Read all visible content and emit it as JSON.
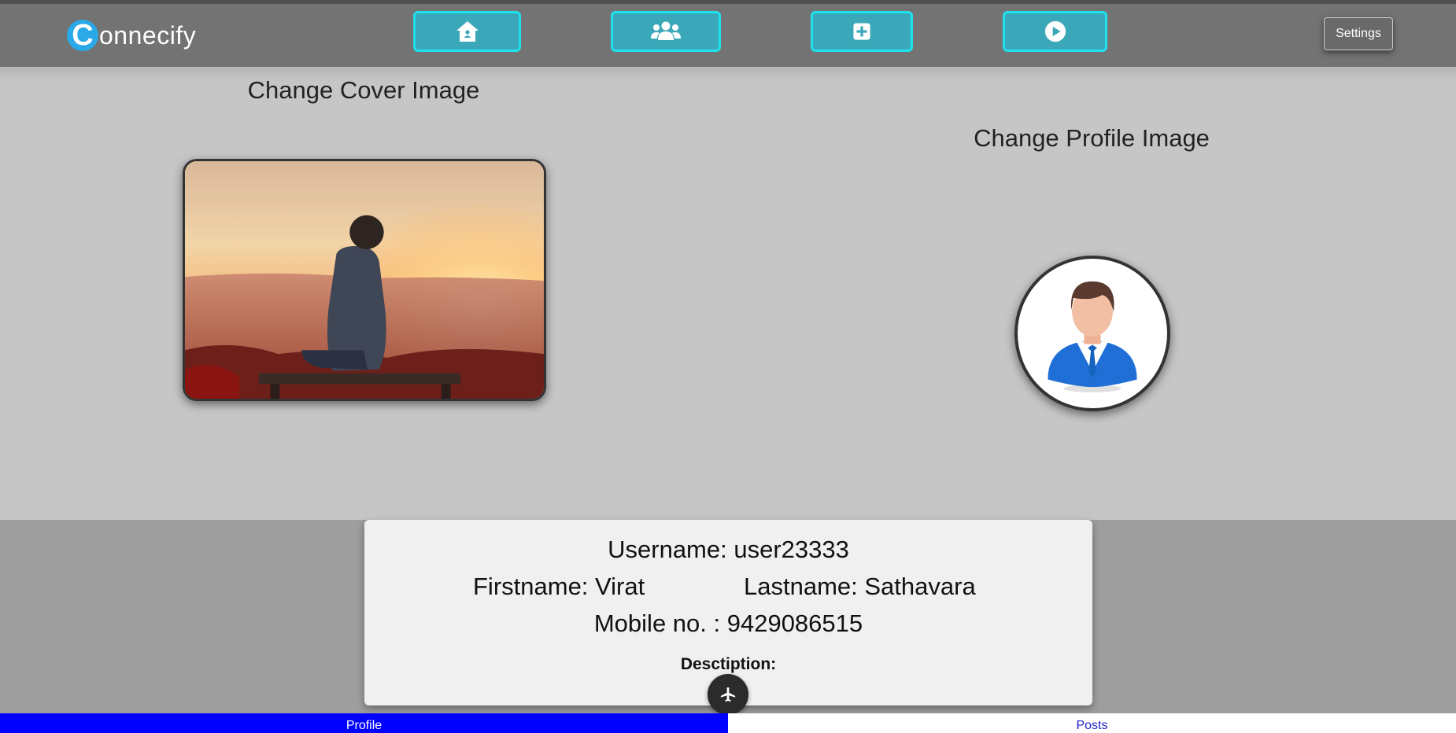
{
  "brand": {
    "logo_letter": "C",
    "name_rest": "onnecify",
    "accent": "#2aa9e8"
  },
  "nav": {
    "buttons": [
      {
        "icon": "home-icon"
      },
      {
        "icon": "users-icon"
      },
      {
        "icon": "add-post-icon"
      },
      {
        "icon": "play-icon"
      }
    ],
    "settings_label": "Settings",
    "button_color": "#3aa8b8",
    "button_border": "#1ee0ee"
  },
  "images": {
    "cover_title": "Change Cover Image",
    "profile_title": "Change Profile Image"
  },
  "profile": {
    "username": "Username: user23333",
    "firstname": "Firstname: Virat",
    "lastname": "Lastname: Sathavara",
    "mobile": "Mobile no. : 9429086515",
    "description_label": "Desctiption:"
  },
  "fab": {
    "icon": "plane-icon"
  },
  "tabs": {
    "profile": "Profile",
    "posts": "Posts",
    "active_color": "#0000ff"
  }
}
